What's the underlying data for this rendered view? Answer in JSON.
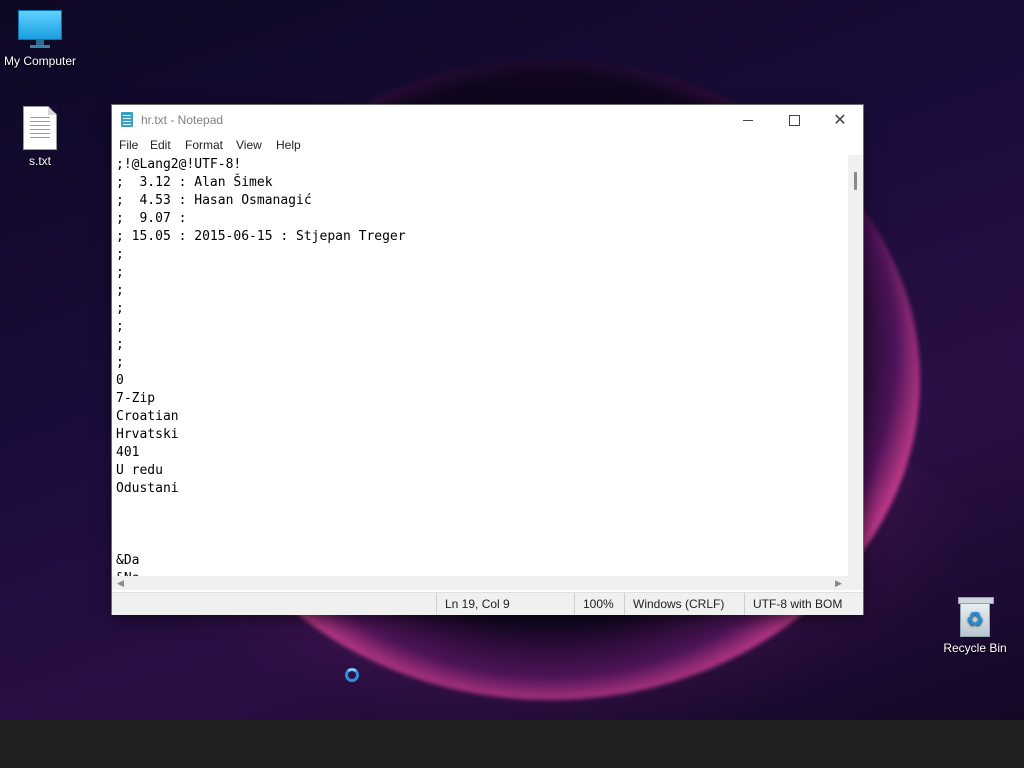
{
  "desktop": {
    "icons": [
      {
        "label": "My Computer",
        "icon": "monitor-icon"
      },
      {
        "label": "s.txt",
        "icon": "text-file-icon"
      },
      {
        "label": "Recycle Bin",
        "icon": "recycle-bin-icon"
      }
    ]
  },
  "window": {
    "title": "hr.txt - Notepad",
    "icon": "notepad-icon",
    "controls": {
      "minimize": "minimize-icon",
      "maximize": "maximize-icon",
      "close": "close-icon"
    }
  },
  "menu": {
    "file": "File",
    "edit": "Edit",
    "format": "Format",
    "view": "View",
    "help": "Help"
  },
  "editor": {
    "text": ";!@Lang2@!UTF-8!\n;  3.12 : Alan Šimek\n;  4.53 : Hasan Osmanagić\n;  9.07 :\n; 15.05 : 2015-06-15 : Stjepan Treger\n;\n;\n;\n;\n;\n;\n;\n0\n7-Zip\nCroatian\nHrvatski\n401\nU redu\nOdustani\n\n\n\n&Da\n&Ne"
  },
  "status": {
    "position": "Ln 19, Col 9",
    "zoom": "100%",
    "line_endings": "Windows (CRLF)",
    "encoding": "UTF-8 with BOM"
  }
}
